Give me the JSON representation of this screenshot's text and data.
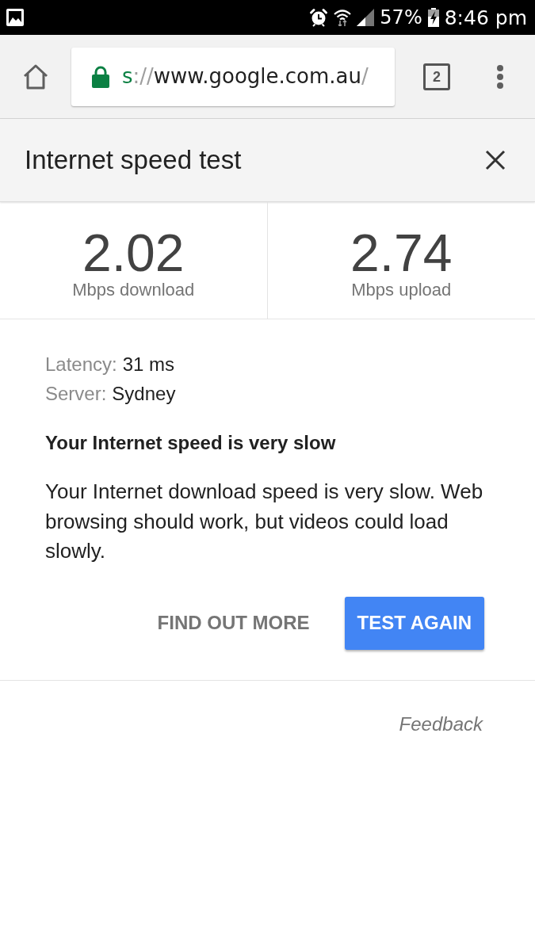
{
  "status_bar": {
    "battery": "57%",
    "time": "8:46 pm"
  },
  "browser_toolbar": {
    "url": {
      "scheme": "s",
      "separator": "://",
      "host": "www.google.com.au",
      "path": "/"
    },
    "tab_count": "2"
  },
  "card": {
    "title": "Internet speed test",
    "results": [
      {
        "value": "2.02",
        "label": "Mbps download"
      },
      {
        "value": "2.74",
        "label": "Mbps upload"
      }
    ],
    "details": [
      {
        "label": "Latency:",
        "value": "31 ms"
      },
      {
        "label": "Server:",
        "value": "Sydney"
      }
    ],
    "heading": "Your Internet speed is very slow",
    "message": "Your Internet download speed is very slow. Web browsing should work, but videos could load slowly.",
    "actions": [
      {
        "label": "FIND OUT MORE",
        "kind": "flat"
      },
      {
        "label": "TEST AGAIN",
        "kind": "raised"
      }
    ]
  },
  "feedback_link": "Feedback"
}
